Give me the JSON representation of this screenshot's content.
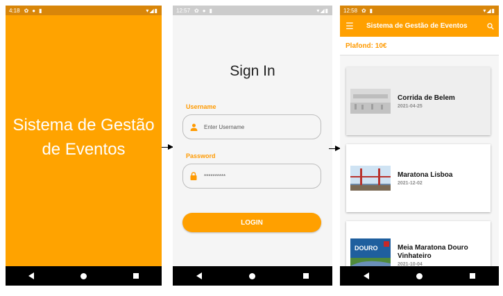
{
  "phone1": {
    "status_time": "4:18",
    "splash_line1": "Sistema de Gestão",
    "splash_line2": "de Eventos"
  },
  "phone2": {
    "status_time": "12:57",
    "title": "Sign In",
    "username_label": "Username",
    "username_placeholder": "Enter Username",
    "password_label": "Password",
    "password_value": "**********",
    "login_label": "LOGIN"
  },
  "phone3": {
    "status_time": "12:58",
    "appbar_title": "Sistema de Gestão de Eventos",
    "plafond": "Plafond: 10€",
    "events": [
      {
        "title": "Corrida de Belem",
        "date": "2021-04-25"
      },
      {
        "title": "Maratona Lisboa",
        "date": "2021-12-02"
      },
      {
        "title": "Meia Maratona Douro Vinhateiro",
        "date": "2021-10-04"
      }
    ],
    "thumb3_text": "DOURO"
  },
  "colors": {
    "accent": "#ffa000",
    "label": "#ff9a00",
    "statusbar": "#d8860a"
  }
}
